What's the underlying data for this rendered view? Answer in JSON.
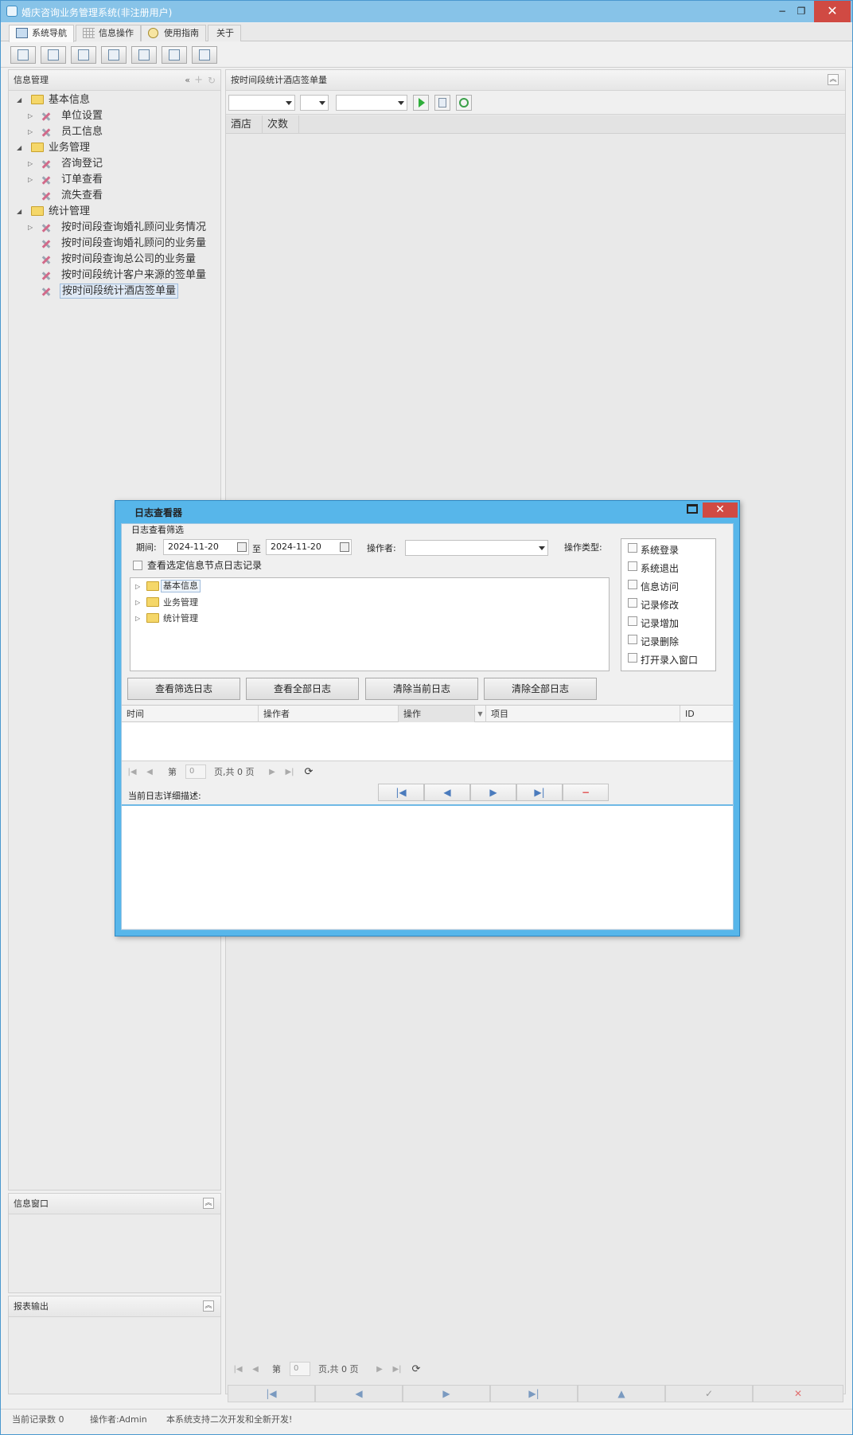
{
  "window": {
    "title": "婚庆咨询业务管理系统(非注册用户)",
    "min": "−",
    "restore": "❐",
    "close": "✕"
  },
  "tabs": [
    {
      "label": "系统导航",
      "active": true
    },
    {
      "label": "信息操作",
      "active": false
    },
    {
      "label": "使用指南",
      "active": false
    },
    {
      "label": "关于",
      "active": false
    }
  ],
  "left_panel": {
    "title": "信息管理",
    "tree": [
      {
        "label": "基本信息"
      },
      {
        "label": "单位设置"
      },
      {
        "label": "员工信息"
      },
      {
        "label": "业务管理"
      },
      {
        "label": "咨询登记"
      },
      {
        "label": "订单查看"
      },
      {
        "label": "流失查看"
      },
      {
        "label": "统计管理"
      },
      {
        "label": "按时间段查询婚礼顾问业务情况"
      },
      {
        "label": "按时间段查询婚礼顾问的业务量"
      },
      {
        "label": "按时间段查询总公司的业务量"
      },
      {
        "label": "按时间段统计客户来源的签单量"
      },
      {
        "label": "按时间段统计酒店签单量"
      }
    ]
  },
  "info_window": {
    "title": "信息窗口"
  },
  "report_output": {
    "title": "报表输出"
  },
  "right_panel": {
    "title": "按时间段统计酒店签单量",
    "columns": [
      "酒店",
      "次数"
    ],
    "pager": {
      "page_prefix": "第",
      "page_value": "0",
      "page_suffix": "页,共 0 页"
    }
  },
  "dialog": {
    "title": "日志查看器",
    "filter_group": "日志查看筛选",
    "period_label": "期间:",
    "date_from": "2024-11-20",
    "to_label": "至",
    "date_to": "2024-11-20",
    "operator_label": "操作者:",
    "optype_label": "操作类型:",
    "optypes": [
      "系统登录",
      "系统退出",
      "信息访问",
      "记录修改",
      "记录增加",
      "记录删除",
      "打开录入窗口"
    ],
    "node_checkbox": "查看选定信息节点日志记录",
    "tree": [
      "基本信息",
      "业务管理",
      "统计管理"
    ],
    "buttons": [
      "查看筛选日志",
      "查看全部日志",
      "清除当前日志",
      "清除全部日志"
    ],
    "columns": [
      "时间",
      "操作者",
      "操作",
      "项目",
      "ID"
    ],
    "pager": {
      "page_prefix": "第",
      "page_value": "0",
      "page_suffix": "页,共 0 页"
    },
    "detail_label": "当前日志详细描述:"
  },
  "status": {
    "record_count": "当前记录数 0",
    "operator": "操作者:Admin",
    "message": "本系统支持二次开发和全新开发!"
  },
  "colors": {
    "titlebar": "#87c3e8",
    "close": "#d04a43",
    "dialog_frame": "#57b6ea"
  }
}
